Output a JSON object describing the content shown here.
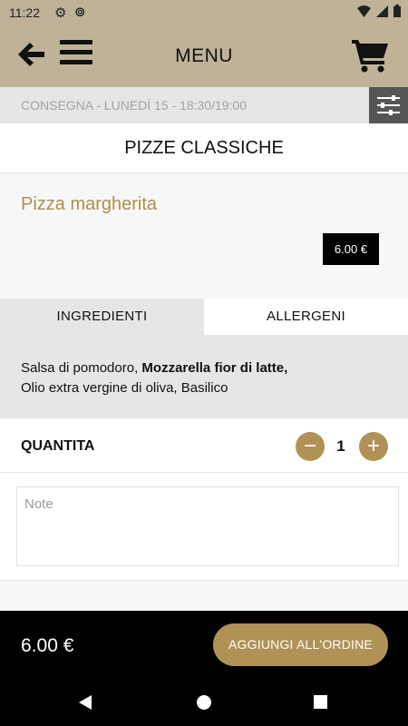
{
  "status_bar": {
    "time": "11:22",
    "icons": [
      "settings-icon",
      "sync-icon",
      "wifi-icon",
      "signal-icon",
      "battery-icon"
    ]
  },
  "app_bar": {
    "title": "MENU",
    "icons": [
      "arrow-left-icon",
      "hamburger-menu-icon",
      "shopping-cart-icon"
    ]
  },
  "delivery": {
    "text": "CONSEGNA - LUNEDÌ 15 - 18:30/19:00",
    "filter_icon": "sliders-icon"
  },
  "category": {
    "title": "PIZZE CLASSICHE"
  },
  "product": {
    "name": "Pizza margherita",
    "price": "6.00 €"
  },
  "tabs": {
    "ingredients": "INGREDIENTI",
    "allergens": "ALLERGENI",
    "active": "ingredients"
  },
  "ingredients": {
    "part1": "Salsa di pomodoro, ",
    "bold": "Mozzarella fior di latte,",
    "part2": "Olio extra vergine di oliva, Basilico"
  },
  "quantity": {
    "label": "QUANTITA",
    "value": "1",
    "minus_symbol": "−",
    "plus_symbol": "+"
  },
  "notes": {
    "placeholder": "Note",
    "value": ""
  },
  "footer": {
    "total": "6.00 €",
    "add_button_label": "AGGIUNGI ALL'ORDINE"
  },
  "colors": {
    "header_bg": "#bfb299",
    "accent": "#b09256",
    "product_name": "#ad8f4c",
    "footer_bg": "#000000"
  }
}
